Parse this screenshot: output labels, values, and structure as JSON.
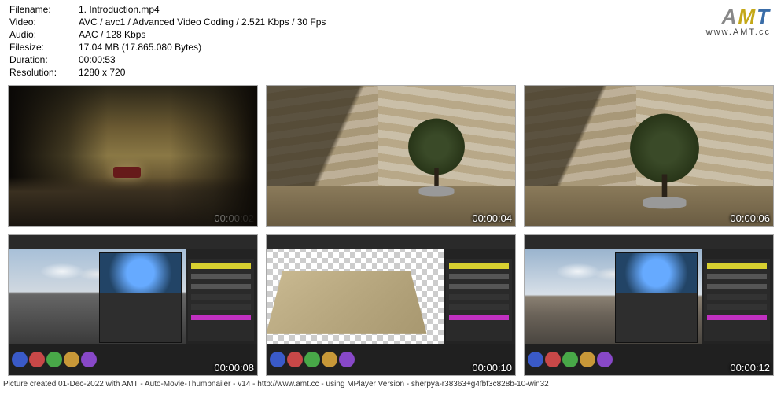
{
  "meta": {
    "labels": {
      "filename": "Filename:",
      "video": "Video:",
      "audio": "Audio:",
      "filesize": "Filesize:",
      "duration": "Duration:",
      "resolution": "Resolution:"
    },
    "filename": "1. Introduction.mp4",
    "video": "AVC / avc1 / Advanced Video Coding / 2.521 Kbps / 30 Fps",
    "audio": "AAC / 128 Kbps",
    "filesize": "17.04 MB (17.865.080 Bytes)",
    "duration": "00:00:53",
    "resolution": "1280 x 720"
  },
  "logo": {
    "a": "A",
    "m": "M",
    "t": "T",
    "url": "www.AMT.cc"
  },
  "thumbs": [
    {
      "ts": "00:00:02"
    },
    {
      "ts": "00:00:04"
    },
    {
      "ts": "00:00:06"
    },
    {
      "ts": "00:00:08"
    },
    {
      "ts": "00:00:10"
    },
    {
      "ts": "00:00:12"
    }
  ],
  "footer": "Picture created 01-Dec-2022 with AMT - Auto-Movie-Thumbnailer - v14 - http://www.amt.cc - using MPlayer Version - sherpya-r38363+g4fbf3c828b-10-win32"
}
